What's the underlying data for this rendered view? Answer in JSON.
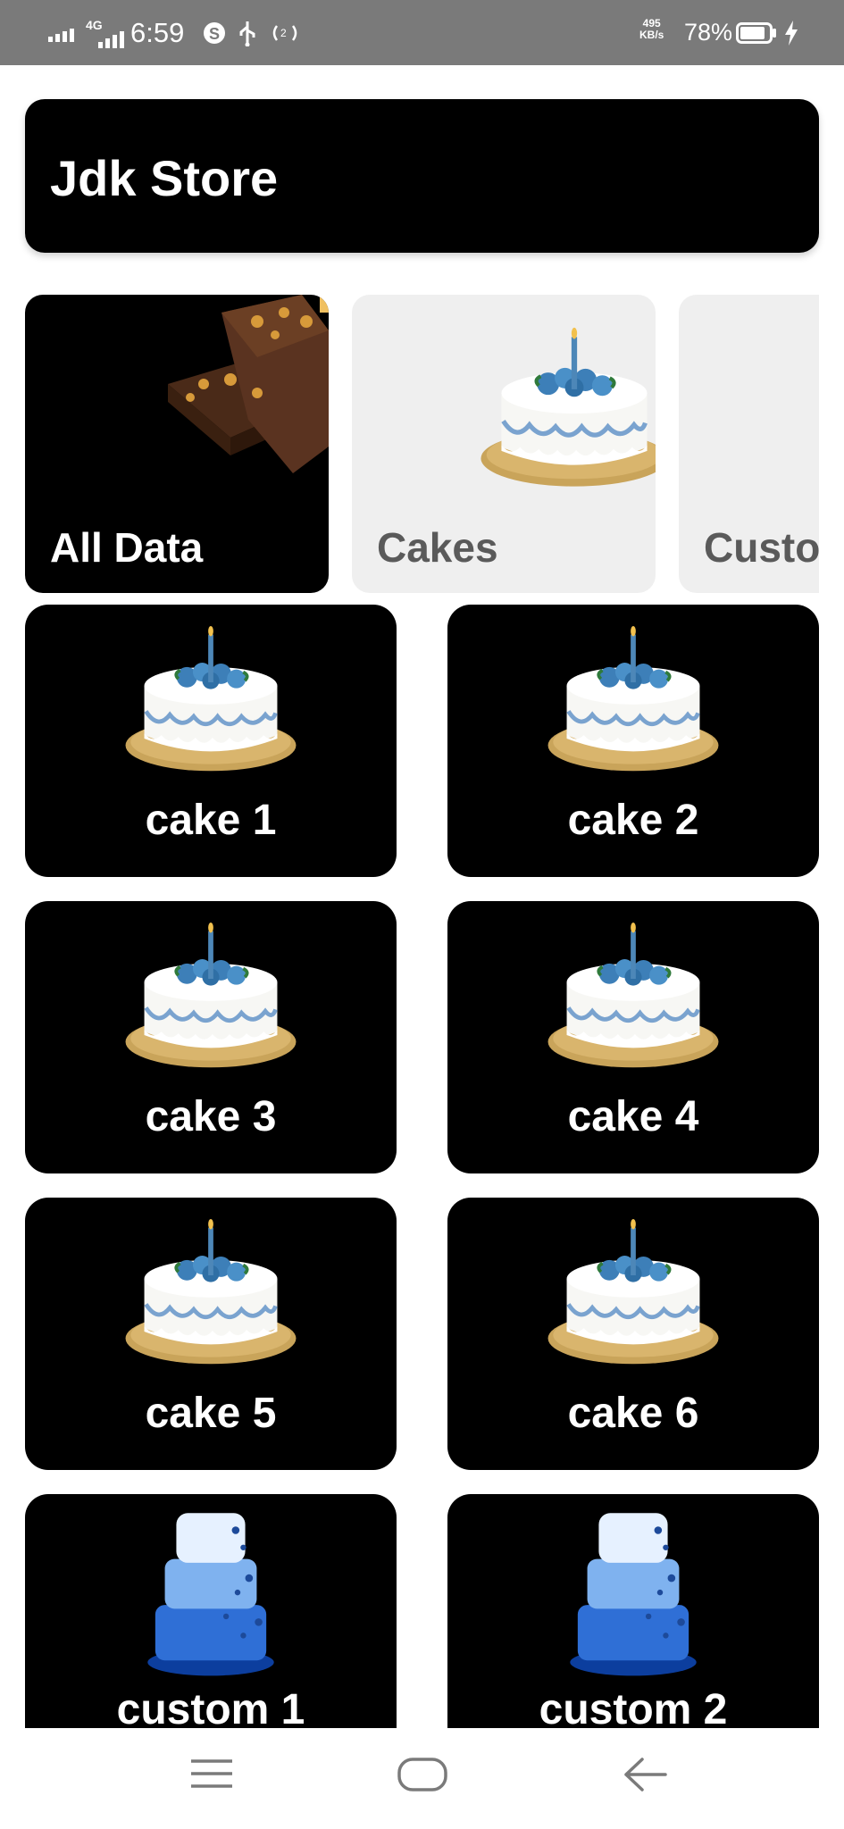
{
  "status_bar": {
    "time": "6:59",
    "network": "4G",
    "net_speed_value": "495",
    "net_speed_unit": "KB/s",
    "battery_percent": "78%",
    "icons": [
      "signal-icon",
      "4g-signal-icon",
      "skype-icon",
      "usb-icon",
      "hotspot-icon",
      "battery-icon",
      "charging-icon"
    ]
  },
  "header": {
    "title": "Jdk Store"
  },
  "categories": [
    {
      "label": "All Data",
      "selected": true,
      "image": "brownie-image"
    },
    {
      "label": "Cakes",
      "selected": false,
      "image": "cake-image"
    },
    {
      "label": "Custo",
      "selected": false,
      "image": "custom-image"
    }
  ],
  "products": [
    {
      "label": "cake 1",
      "image": "cake-image"
    },
    {
      "label": "cake 2",
      "image": "cake-image"
    },
    {
      "label": "cake 3",
      "image": "cake-image"
    },
    {
      "label": "cake 4",
      "image": "cake-image"
    },
    {
      "label": "cake 5",
      "image": "cake-image"
    },
    {
      "label": "cake 6",
      "image": "cake-image"
    },
    {
      "label": "custom 1",
      "image": "tiered-cake-image"
    },
    {
      "label": "custom 2",
      "image": "tiered-cake-image"
    }
  ],
  "nav_bar": {
    "buttons": [
      "menu-icon",
      "home-icon",
      "back-icon"
    ]
  },
  "colors": {
    "status_bar_bg": "#7a7a7a",
    "card_bg": "#000000",
    "chip_inactive_bg": "#efefef",
    "chip_inactive_text": "#5a5a5a",
    "text_on_dark": "#ffffff"
  }
}
